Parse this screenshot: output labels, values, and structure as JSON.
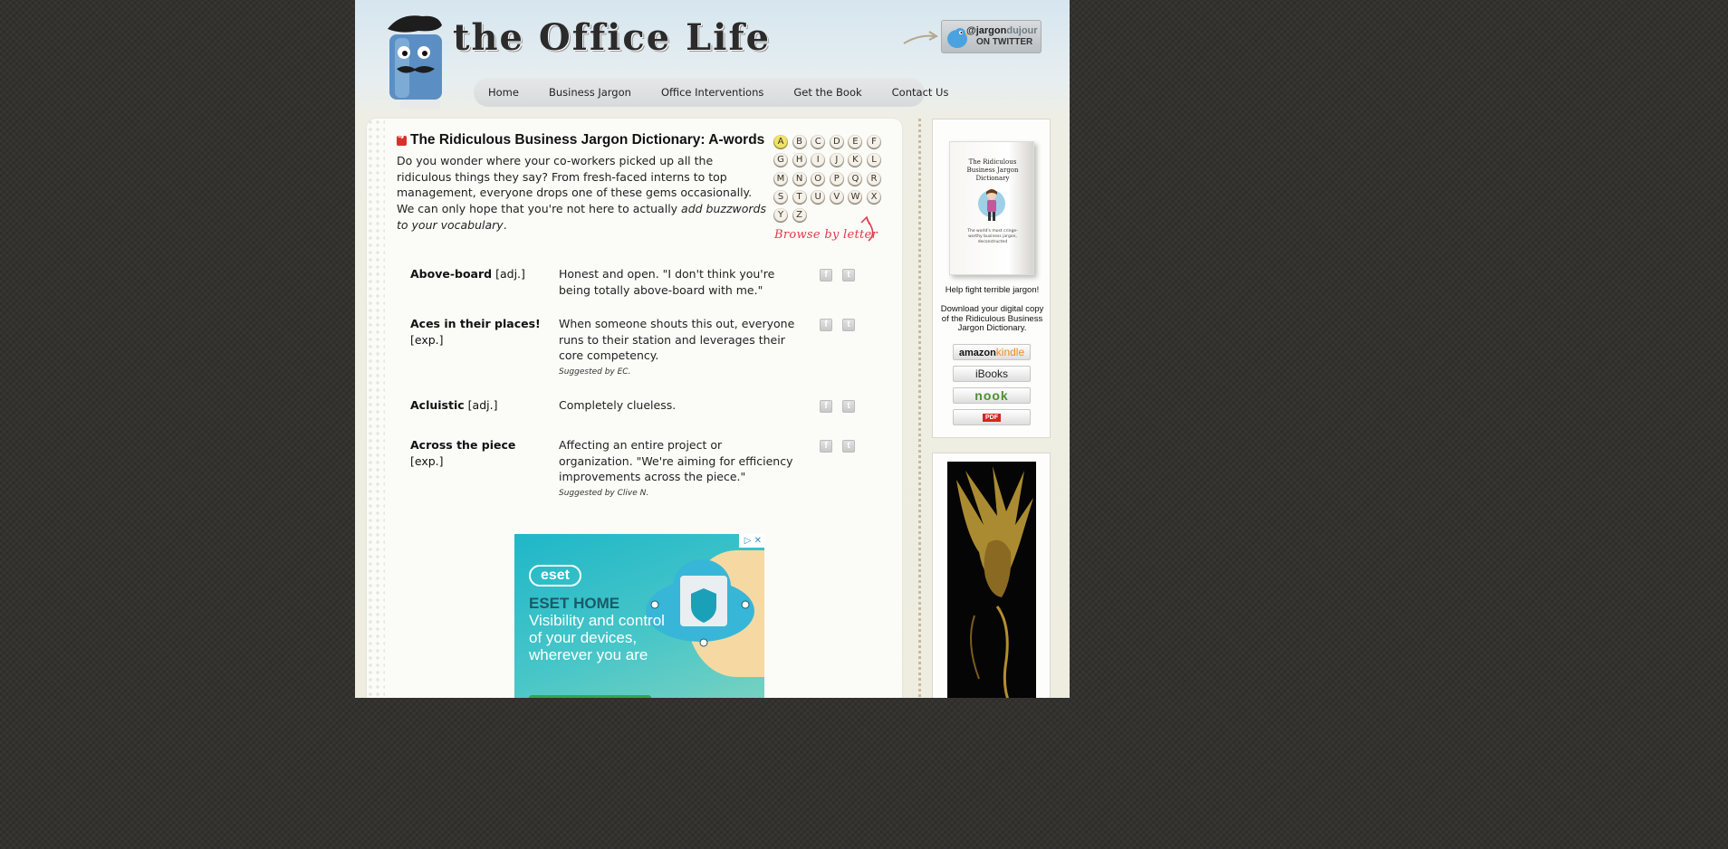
{
  "site": {
    "logo_text": "the Office Life",
    "twitter": {
      "handle_dark": "@jargon",
      "handle_light": "dujour",
      "sub": "ON TWITTER"
    }
  },
  "nav": [
    "Home",
    "Business Jargon",
    "Office Interventions",
    "Get the Book",
    "Contact Us"
  ],
  "main": {
    "title": "The Ridiculous Business Jargon Dictionary: A-words",
    "intro_plain": "Do you wonder where your co-workers picked up all the ridiculous things they say? From fresh-faced interns to top management, everyone drops one of these gems occasionally. We can only hope that you're not here to actually ",
    "intro_em": "add buzzwords to your vocabulary",
    "intro_end": ".",
    "letters": [
      "A",
      "B",
      "C",
      "D",
      "E",
      "F",
      "G",
      "H",
      "I",
      "J",
      "K",
      "L",
      "M",
      "N",
      "O",
      "P",
      "Q",
      "R",
      "S",
      "T",
      "U",
      "V",
      "W",
      "X",
      "Y",
      "Z"
    ],
    "active_letter": "A",
    "browse_label": "Browse by letter",
    "entries": [
      {
        "term": "Above-board",
        "type": "[adj.]",
        "definition": "Honest and open. \"I don't think you're being totally above-board with me.\"",
        "credit": ""
      },
      {
        "term": "Aces in their places!",
        "type": "[exp.]",
        "definition": "When someone shouts this out, everyone runs to their station and leverages their core competency.",
        "credit": "Suggested by EC."
      },
      {
        "term": "Acluistic",
        "type": "[adj.]",
        "definition": "Completely clueless.",
        "credit": ""
      },
      {
        "term": "Across the piece",
        "type": "[exp.]",
        "definition": "Affecting an entire project or organization. \"We're aiming for efficiency improvements across the piece.\"",
        "credit": "Suggested by Clive N."
      }
    ],
    "share_fb": "f",
    "share_tw": "t"
  },
  "ad": {
    "logo": "eset",
    "headline": "ESET HOME",
    "body": "Visibility and control of your devices, wherever you are",
    "close_label": "▷ ✕"
  },
  "sidebar": {
    "book_title": "The Ridiculous Business Jargon Dictionary",
    "book_sub": "The world's most cringe-worthy business jargon, deconstructed",
    "tagline": "Help fight terrible jargon!",
    "download_text": "Download your digital copy of the Ridiculous Business Jargon Dictionary.",
    "stores": {
      "amazon": "amazon",
      "kindle": "kindle",
      "ibooks": "iBooks",
      "nook": "nook",
      "pdf": "PDF"
    }
  },
  "colors": {
    "page_bg": "#33322f",
    "accent_red": "#e0394a",
    "bullet_red": "#d8302a"
  }
}
